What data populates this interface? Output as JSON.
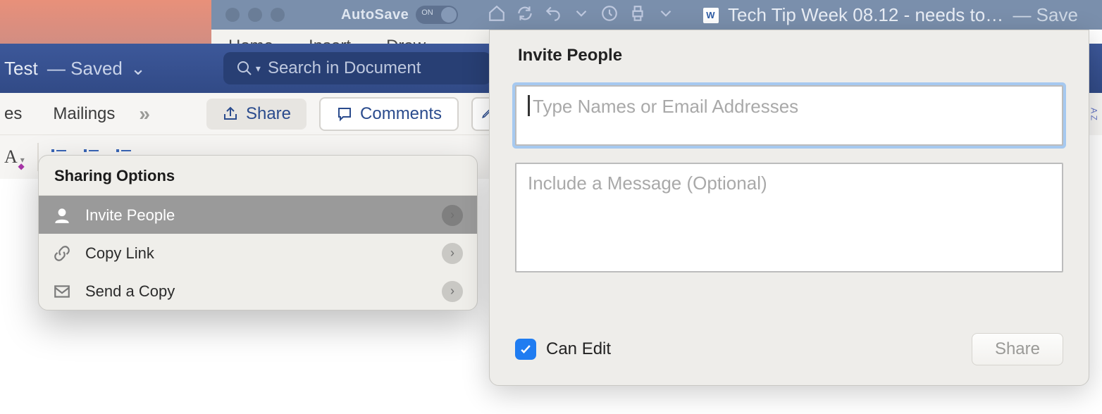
{
  "bg_window": {
    "autosave_label": "AutoSave",
    "autosave_state": "ON",
    "doc_title": "Tech Tip Week 08.12 - needs to…",
    "saved_label": "— Save"
  },
  "bg_tabs": [
    "Home",
    "Insert",
    "Draw"
  ],
  "front_window": {
    "doc_title": "Test",
    "saved_label": "— Saved",
    "search_placeholder": "Search in Document"
  },
  "tabs_row": {
    "partial_tab": "es",
    "mailings": "Mailings",
    "overflow": "»",
    "share": "Share",
    "comments": "Comments"
  },
  "share_popover": {
    "title": "Sharing Options",
    "items": [
      {
        "icon": "person-icon",
        "label": "Invite People",
        "selected": true
      },
      {
        "icon": "link-icon",
        "label": "Copy Link",
        "selected": false
      },
      {
        "icon": "envelope-icon",
        "label": "Send a Copy",
        "selected": false
      }
    ]
  },
  "invite_panel": {
    "title": "Invite People",
    "names_placeholder": "Type Names or Email Addresses",
    "message_placeholder": "Include a Message (Optional)",
    "can_edit_label": "Can Edit",
    "can_edit_checked": true,
    "share_button": "Share"
  },
  "right_edge": "A\nZ"
}
